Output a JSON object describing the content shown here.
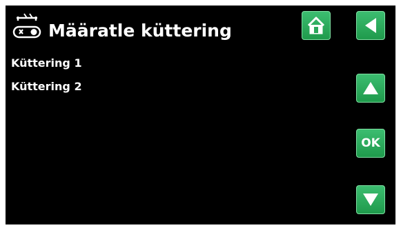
{
  "header": {
    "title": "Määratle küttering",
    "icon": "heating-circuit-icon"
  },
  "list": {
    "items": [
      {
        "label": "Küttering 1"
      },
      {
        "label": "Küttering 2"
      }
    ]
  },
  "buttons": {
    "home_icon": "home-icon",
    "back_icon": "back-arrow-icon",
    "up_icon": "up-arrow-icon",
    "ok_label": "OK",
    "down_icon": "down-arrow-icon"
  },
  "colors": {
    "background": "#000000",
    "text": "#ffffff",
    "button_green": "#2aa85b"
  }
}
